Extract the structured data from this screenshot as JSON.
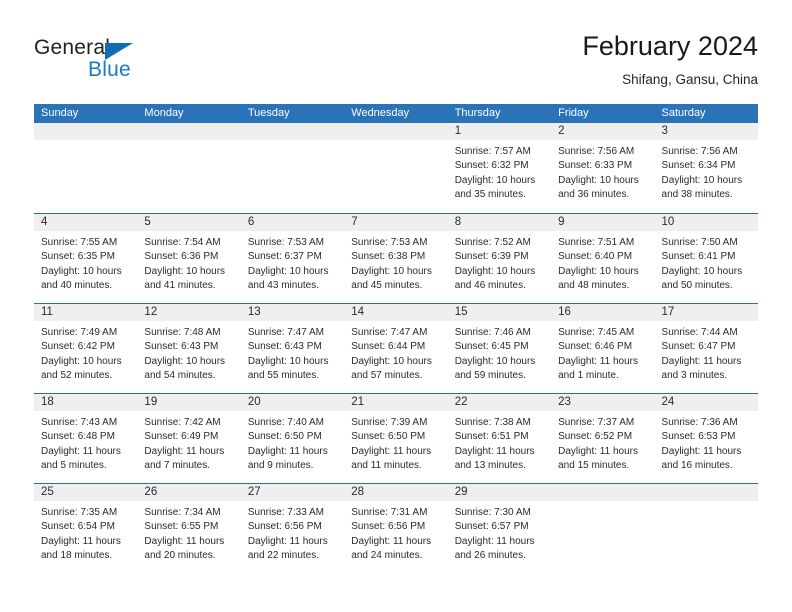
{
  "brand": {
    "name_part1": "General",
    "name_part2": "Blue",
    "triangle_color": "#0f6cb5",
    "blue_color": "#1b7ac4"
  },
  "header": {
    "title": "February 2024",
    "subtitle": "Shifang, Gansu, China"
  },
  "theme": {
    "header_row_bg": "#2b73b8",
    "row_divider": "#2b6cad",
    "day_band_bg": "#efefef",
    "text": "#2b2b2b"
  },
  "calendar": {
    "weekdays": [
      "Sunday",
      "Monday",
      "Tuesday",
      "Wednesday",
      "Thursday",
      "Friday",
      "Saturday"
    ],
    "weeks": [
      [
        {
          "day": "",
          "sunrise": "",
          "sunset": "",
          "daylight_line1": "",
          "daylight_line2": "",
          "empty": true
        },
        {
          "day": "",
          "sunrise": "",
          "sunset": "",
          "daylight_line1": "",
          "daylight_line2": "",
          "empty": true
        },
        {
          "day": "",
          "sunrise": "",
          "sunset": "",
          "daylight_line1": "",
          "daylight_line2": "",
          "empty": true
        },
        {
          "day": "",
          "sunrise": "",
          "sunset": "",
          "daylight_line1": "",
          "daylight_line2": "",
          "empty": true
        },
        {
          "day": "1",
          "sunrise": "Sunrise: 7:57 AM",
          "sunset": "Sunset: 6:32 PM",
          "daylight_line1": "Daylight: 10 hours",
          "daylight_line2": "and 35 minutes.",
          "empty": false
        },
        {
          "day": "2",
          "sunrise": "Sunrise: 7:56 AM",
          "sunset": "Sunset: 6:33 PM",
          "daylight_line1": "Daylight: 10 hours",
          "daylight_line2": "and 36 minutes.",
          "empty": false
        },
        {
          "day": "3",
          "sunrise": "Sunrise: 7:56 AM",
          "sunset": "Sunset: 6:34 PM",
          "daylight_line1": "Daylight: 10 hours",
          "daylight_line2": "and 38 minutes.",
          "empty": false
        }
      ],
      [
        {
          "day": "4",
          "sunrise": "Sunrise: 7:55 AM",
          "sunset": "Sunset: 6:35 PM",
          "daylight_line1": "Daylight: 10 hours",
          "daylight_line2": "and 40 minutes.",
          "empty": false
        },
        {
          "day": "5",
          "sunrise": "Sunrise: 7:54 AM",
          "sunset": "Sunset: 6:36 PM",
          "daylight_line1": "Daylight: 10 hours",
          "daylight_line2": "and 41 minutes.",
          "empty": false
        },
        {
          "day": "6",
          "sunrise": "Sunrise: 7:53 AM",
          "sunset": "Sunset: 6:37 PM",
          "daylight_line1": "Daylight: 10 hours",
          "daylight_line2": "and 43 minutes.",
          "empty": false
        },
        {
          "day": "7",
          "sunrise": "Sunrise: 7:53 AM",
          "sunset": "Sunset: 6:38 PM",
          "daylight_line1": "Daylight: 10 hours",
          "daylight_line2": "and 45 minutes.",
          "empty": false
        },
        {
          "day": "8",
          "sunrise": "Sunrise: 7:52 AM",
          "sunset": "Sunset: 6:39 PM",
          "daylight_line1": "Daylight: 10 hours",
          "daylight_line2": "and 46 minutes.",
          "empty": false
        },
        {
          "day": "9",
          "sunrise": "Sunrise: 7:51 AM",
          "sunset": "Sunset: 6:40 PM",
          "daylight_line1": "Daylight: 10 hours",
          "daylight_line2": "and 48 minutes.",
          "empty": false
        },
        {
          "day": "10",
          "sunrise": "Sunrise: 7:50 AM",
          "sunset": "Sunset: 6:41 PM",
          "daylight_line1": "Daylight: 10 hours",
          "daylight_line2": "and 50 minutes.",
          "empty": false
        }
      ],
      [
        {
          "day": "11",
          "sunrise": "Sunrise: 7:49 AM",
          "sunset": "Sunset: 6:42 PM",
          "daylight_line1": "Daylight: 10 hours",
          "daylight_line2": "and 52 minutes.",
          "empty": false
        },
        {
          "day": "12",
          "sunrise": "Sunrise: 7:48 AM",
          "sunset": "Sunset: 6:43 PM",
          "daylight_line1": "Daylight: 10 hours",
          "daylight_line2": "and 54 minutes.",
          "empty": false
        },
        {
          "day": "13",
          "sunrise": "Sunrise: 7:47 AM",
          "sunset": "Sunset: 6:43 PM",
          "daylight_line1": "Daylight: 10 hours",
          "daylight_line2": "and 55 minutes.",
          "empty": false
        },
        {
          "day": "14",
          "sunrise": "Sunrise: 7:47 AM",
          "sunset": "Sunset: 6:44 PM",
          "daylight_line1": "Daylight: 10 hours",
          "daylight_line2": "and 57 minutes.",
          "empty": false
        },
        {
          "day": "15",
          "sunrise": "Sunrise: 7:46 AM",
          "sunset": "Sunset: 6:45 PM",
          "daylight_line1": "Daylight: 10 hours",
          "daylight_line2": "and 59 minutes.",
          "empty": false
        },
        {
          "day": "16",
          "sunrise": "Sunrise: 7:45 AM",
          "sunset": "Sunset: 6:46 PM",
          "daylight_line1": "Daylight: 11 hours",
          "daylight_line2": "and 1 minute.",
          "empty": false
        },
        {
          "day": "17",
          "sunrise": "Sunrise: 7:44 AM",
          "sunset": "Sunset: 6:47 PM",
          "daylight_line1": "Daylight: 11 hours",
          "daylight_line2": "and 3 minutes.",
          "empty": false
        }
      ],
      [
        {
          "day": "18",
          "sunrise": "Sunrise: 7:43 AM",
          "sunset": "Sunset: 6:48 PM",
          "daylight_line1": "Daylight: 11 hours",
          "daylight_line2": "and 5 minutes.",
          "empty": false
        },
        {
          "day": "19",
          "sunrise": "Sunrise: 7:42 AM",
          "sunset": "Sunset: 6:49 PM",
          "daylight_line1": "Daylight: 11 hours",
          "daylight_line2": "and 7 minutes.",
          "empty": false
        },
        {
          "day": "20",
          "sunrise": "Sunrise: 7:40 AM",
          "sunset": "Sunset: 6:50 PM",
          "daylight_line1": "Daylight: 11 hours",
          "daylight_line2": "and 9 minutes.",
          "empty": false
        },
        {
          "day": "21",
          "sunrise": "Sunrise: 7:39 AM",
          "sunset": "Sunset: 6:50 PM",
          "daylight_line1": "Daylight: 11 hours",
          "daylight_line2": "and 11 minutes.",
          "empty": false
        },
        {
          "day": "22",
          "sunrise": "Sunrise: 7:38 AM",
          "sunset": "Sunset: 6:51 PM",
          "daylight_line1": "Daylight: 11 hours",
          "daylight_line2": "and 13 minutes.",
          "empty": false
        },
        {
          "day": "23",
          "sunrise": "Sunrise: 7:37 AM",
          "sunset": "Sunset: 6:52 PM",
          "daylight_line1": "Daylight: 11 hours",
          "daylight_line2": "and 15 minutes.",
          "empty": false
        },
        {
          "day": "24",
          "sunrise": "Sunrise: 7:36 AM",
          "sunset": "Sunset: 6:53 PM",
          "daylight_line1": "Daylight: 11 hours",
          "daylight_line2": "and 16 minutes.",
          "empty": false
        }
      ],
      [
        {
          "day": "25",
          "sunrise": "Sunrise: 7:35 AM",
          "sunset": "Sunset: 6:54 PM",
          "daylight_line1": "Daylight: 11 hours",
          "daylight_line2": "and 18 minutes.",
          "empty": false
        },
        {
          "day": "26",
          "sunrise": "Sunrise: 7:34 AM",
          "sunset": "Sunset: 6:55 PM",
          "daylight_line1": "Daylight: 11 hours",
          "daylight_line2": "and 20 minutes.",
          "empty": false
        },
        {
          "day": "27",
          "sunrise": "Sunrise: 7:33 AM",
          "sunset": "Sunset: 6:56 PM",
          "daylight_line1": "Daylight: 11 hours",
          "daylight_line2": "and 22 minutes.",
          "empty": false
        },
        {
          "day": "28",
          "sunrise": "Sunrise: 7:31 AM",
          "sunset": "Sunset: 6:56 PM",
          "daylight_line1": "Daylight: 11 hours",
          "daylight_line2": "and 24 minutes.",
          "empty": false
        },
        {
          "day": "29",
          "sunrise": "Sunrise: 7:30 AM",
          "sunset": "Sunset: 6:57 PM",
          "daylight_line1": "Daylight: 11 hours",
          "daylight_line2": "and 26 minutes.",
          "empty": false
        },
        {
          "day": "",
          "sunrise": "",
          "sunset": "",
          "daylight_line1": "",
          "daylight_line2": "",
          "empty": true
        },
        {
          "day": "",
          "sunrise": "",
          "sunset": "",
          "daylight_line1": "",
          "daylight_line2": "",
          "empty": true
        }
      ]
    ]
  }
}
